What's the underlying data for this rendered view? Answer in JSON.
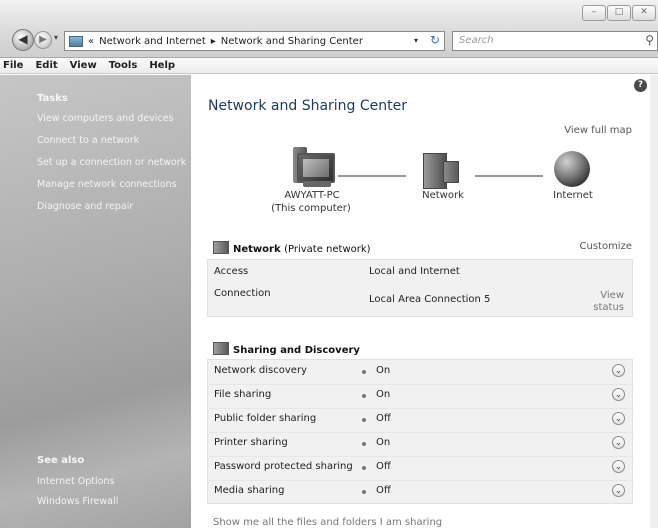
{
  "window": {
    "controls": [
      "–",
      "□",
      "✕"
    ]
  },
  "nav": {
    "back_glyph": "◀",
    "forward_glyph": "▶",
    "recent_glyph": "▾"
  },
  "address": {
    "prefix": "«",
    "crumb1": "Network and Internet",
    "separator": "▸",
    "crumb2": "Network and Sharing Center",
    "dropdown_glyph": "▾",
    "refresh_glyph": "↻"
  },
  "search": {
    "placeholder": "Search",
    "icon_glyph": "⚲"
  },
  "menu": [
    "File",
    "Edit",
    "View",
    "Tools",
    "Help"
  ],
  "sidebar": {
    "tasks_heading": "Tasks",
    "tasks": [
      "View computers and devices",
      "Connect to a network",
      "Set up a connection or network",
      "Manage network connections",
      "Diagnose and repair"
    ],
    "see_also_heading": "See also",
    "see_also": [
      "Internet Options",
      "Windows Firewall"
    ]
  },
  "main": {
    "help_glyph": "?",
    "title": "Network and Sharing Center",
    "view_full_map": "View full map",
    "map": {
      "computer_name": "AWYATT-PC",
      "computer_sub": "(This computer)",
      "network_label": "Network",
      "internet_label": "Internet"
    },
    "network_section": {
      "title_bold": "Network",
      "title_normal": "(Private network)",
      "customize": "Customize",
      "access_label": "Access",
      "access_value": "Local and Internet",
      "connection_label": "Connection",
      "connection_value": "Local Area Connection 5",
      "view_status_line1": "View",
      "view_status_line2": "status"
    },
    "sharing_section": {
      "title": "Sharing and Discovery",
      "expand_glyph": "⌄",
      "rows": [
        {
          "label": "Network discovery",
          "status": "On"
        },
        {
          "label": "File sharing",
          "status": "On"
        },
        {
          "label": "Public folder sharing",
          "status": "Off"
        },
        {
          "label": "Printer sharing",
          "status": "On"
        },
        {
          "label": "Password protected sharing",
          "status": "Off"
        },
        {
          "label": "Media sharing",
          "status": "Off"
        }
      ]
    },
    "show_files": "Show me all the files and folders I am sharing"
  }
}
